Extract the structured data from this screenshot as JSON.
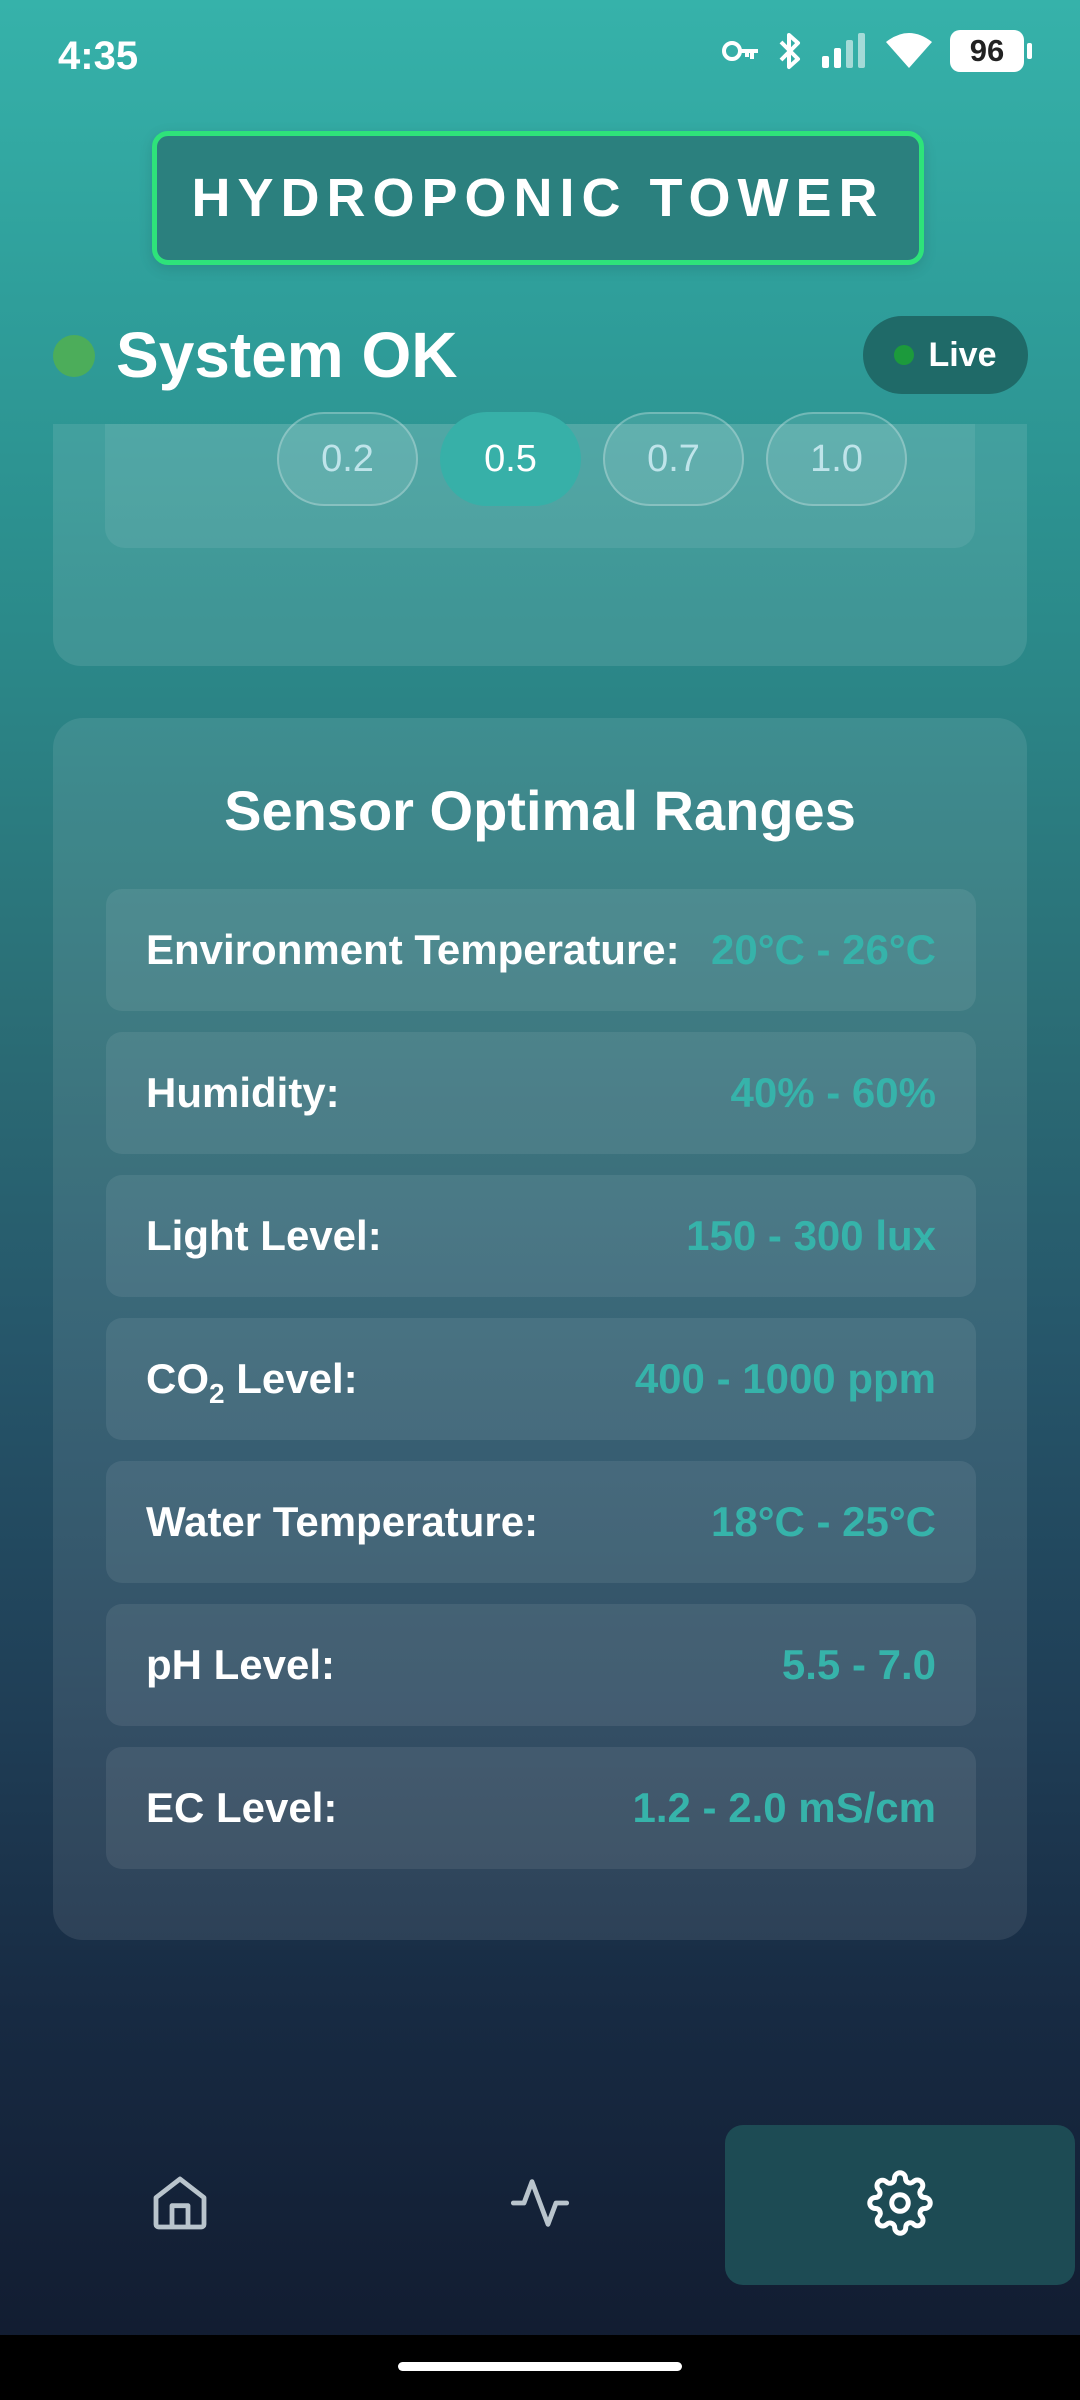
{
  "status_bar": {
    "time": "4:35",
    "battery": "96",
    "icons": [
      "key-icon",
      "bluetooth-icon",
      "signal-icon",
      "wifi-icon",
      "battery-icon"
    ]
  },
  "header": {
    "title": "HYDROPONIC TOWER",
    "border_color": "#2ee37a"
  },
  "system": {
    "status_text": "System OK",
    "status_color": "#4cad5a",
    "live_label": "Live",
    "live_dot_color": "#1c9a3c"
  },
  "interval_options": {
    "options": [
      "0.2",
      "0.5",
      "0.7",
      "1.0"
    ],
    "selected": "0.5"
  },
  "sensor_ranges": {
    "title": "Sensor Optimal Ranges",
    "value_color": "#36b3aa",
    "rows": [
      {
        "label": "Environment Temperature:",
        "value": "20°C - 26°C"
      },
      {
        "label": "Humidity:",
        "value": "40% - 60%"
      },
      {
        "label": "Light Level:",
        "value": "150 - 300 lux"
      },
      {
        "label_prefix": "CO",
        "label_sub": "2",
        "label_suffix": " Level:",
        "value": "400 - 1000 ppm"
      },
      {
        "label": "Water Temperature:",
        "value": "18°C - 25°C"
      },
      {
        "label": "pH Level:",
        "value": "5.5 - 7.0"
      },
      {
        "label": "EC Level:",
        "value": "1.2 - 2.0 mS/cm"
      }
    ]
  },
  "bottom_nav": {
    "items": [
      {
        "icon": "home-icon",
        "active": false
      },
      {
        "icon": "activity-icon",
        "active": false
      },
      {
        "icon": "gear-icon",
        "active": true
      }
    ]
  }
}
